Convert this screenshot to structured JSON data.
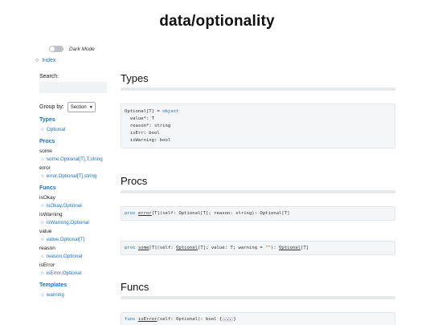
{
  "page": {
    "title": "data/optionality"
  },
  "sidebar": {
    "dark_mode_label": "Dark Mode",
    "index_label": "Index",
    "search_label": "Search:",
    "search_value": "",
    "group_by_label": "Group by:",
    "group_by_value": "Section",
    "sections": [
      {
        "title": "Types",
        "groups": [
          {
            "name": "",
            "items": [
              "Optional"
            ]
          }
        ]
      },
      {
        "title": "Procs",
        "groups": [
          {
            "name": "some",
            "items": [
              "some,Optional[T],T,string"
            ]
          },
          {
            "name": "error",
            "items": [
              "error,Optional[T],string"
            ]
          }
        ]
      },
      {
        "title": "Funcs",
        "groups": [
          {
            "name": "isOkay",
            "items": [
              "isOkay,Optional"
            ]
          },
          {
            "name": "isWarning",
            "items": [
              "isWarning,Optional"
            ]
          },
          {
            "name": "value",
            "items": [
              "value,Optional[T]"
            ]
          },
          {
            "name": "reason",
            "items": [
              "reason,Optional"
            ]
          },
          {
            "name": "isError",
            "items": [
              "isError,Optional"
            ]
          }
        ]
      },
      {
        "title": "Templates",
        "groups": [
          {
            "name": "",
            "items": [
              "warning"
            ]
          }
        ]
      }
    ]
  },
  "main": {
    "types_heading": "Types",
    "procs_heading": "Procs",
    "funcs_heading": "Funcs",
    "type_def": {
      "name": "Optional[T]",
      "eq": " = ",
      "kw": "object",
      "fields": [
        "  value*: T",
        "  reason*: string",
        "  isErr: bool",
        "  isWarning: bool"
      ]
    },
    "proc_error": {
      "kw": "proc ",
      "name": "error",
      "sig": "[T](self: Optional[T]; reason: string): Optional[T]"
    },
    "proc_some": {
      "kw": "proc ",
      "name": "some",
      "sig_a": "[T](self: ",
      "sig_b": "Optional",
      "sig_c": "[T]; value: T; warning = ",
      "str": "\"\"",
      "sig_d": "): ",
      "ret": "Optional",
      "sig_e": "[T]"
    },
    "func_iserror": {
      "kw": "func ",
      "name": "isError",
      "sig": "(self: Optional): bool {",
      "ellipsis": "...",
      "close": "}"
    }
  }
}
